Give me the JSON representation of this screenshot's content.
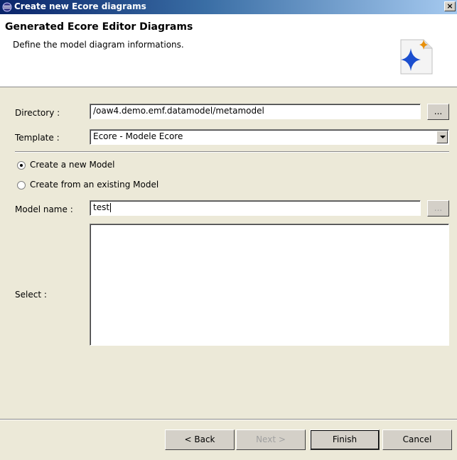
{
  "window": {
    "title": "Create new Ecore diagrams",
    "close_glyph": "×"
  },
  "header": {
    "title": "Generated Ecore Editor Diagrams",
    "description": "Define the model diagram informations."
  },
  "form": {
    "directory_label": "Directory :",
    "directory_value": "/oaw4.demo.emf.datamodel/metamodel",
    "browse_label": "...",
    "template_label": "Template :",
    "template_value": "Ecore - Modele Ecore",
    "radio_new": "Create a new Model",
    "radio_existing": "Create from an existing Model",
    "model_name_label": "Model name :",
    "model_name_value": "test",
    "model_browse_label": "...",
    "select_label": "Select :"
  },
  "buttons": {
    "back": "< Back",
    "next": "Next >",
    "finish": "Finish",
    "cancel": "Cancel"
  },
  "colors": {
    "titlebar_start": "#0a246a",
    "titlebar_end": "#a6caf0",
    "dialog_bg": "#ece9d8",
    "icon_blue": "#1c4fcf",
    "icon_orange": "#e8900a"
  }
}
